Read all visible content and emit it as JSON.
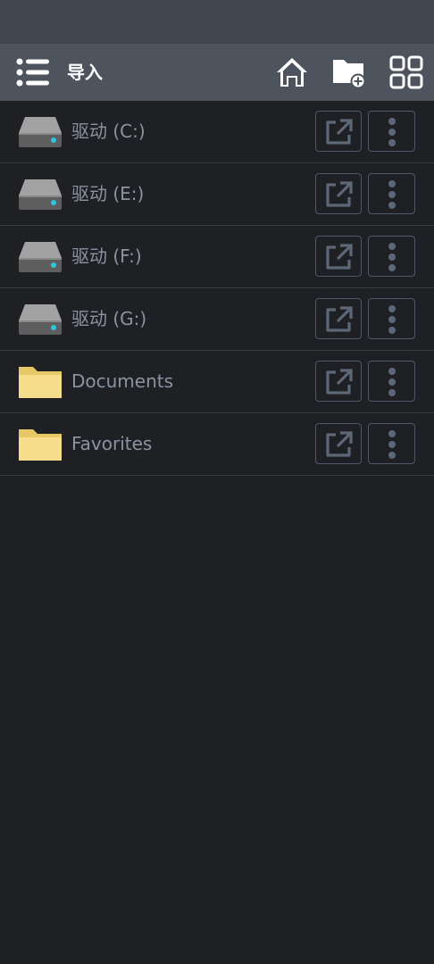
{
  "toolbar": {
    "menu_icon": "list-menu-icon",
    "title": "导入",
    "home_icon": "home-icon",
    "new_folder_icon": "new-folder-icon",
    "grid_icon": "grid-view-icon"
  },
  "items": [
    {
      "label": "驱动 (C:)",
      "type": "drive",
      "icon": "hard-drive-icon"
    },
    {
      "label": "驱动 (E:)",
      "type": "drive",
      "icon": "hard-drive-icon"
    },
    {
      "label": "驱动 (F:)",
      "type": "drive",
      "icon": "hard-drive-icon"
    },
    {
      "label": "驱动 (G:)",
      "type": "drive",
      "icon": "hard-drive-icon"
    },
    {
      "label": "Documents",
      "type": "folder",
      "icon": "folder-icon"
    },
    {
      "label": "Favorites",
      "type": "folder",
      "icon": "folder-icon"
    }
  ],
  "colors": {
    "background": "#1f2024",
    "statusbar": "#404650",
    "toolbar": "#4d545d",
    "label_text": "#8a94a0",
    "button_border": "#4f5866",
    "folder": "#f5dd8c",
    "drive_led": "#2bc6e0"
  }
}
